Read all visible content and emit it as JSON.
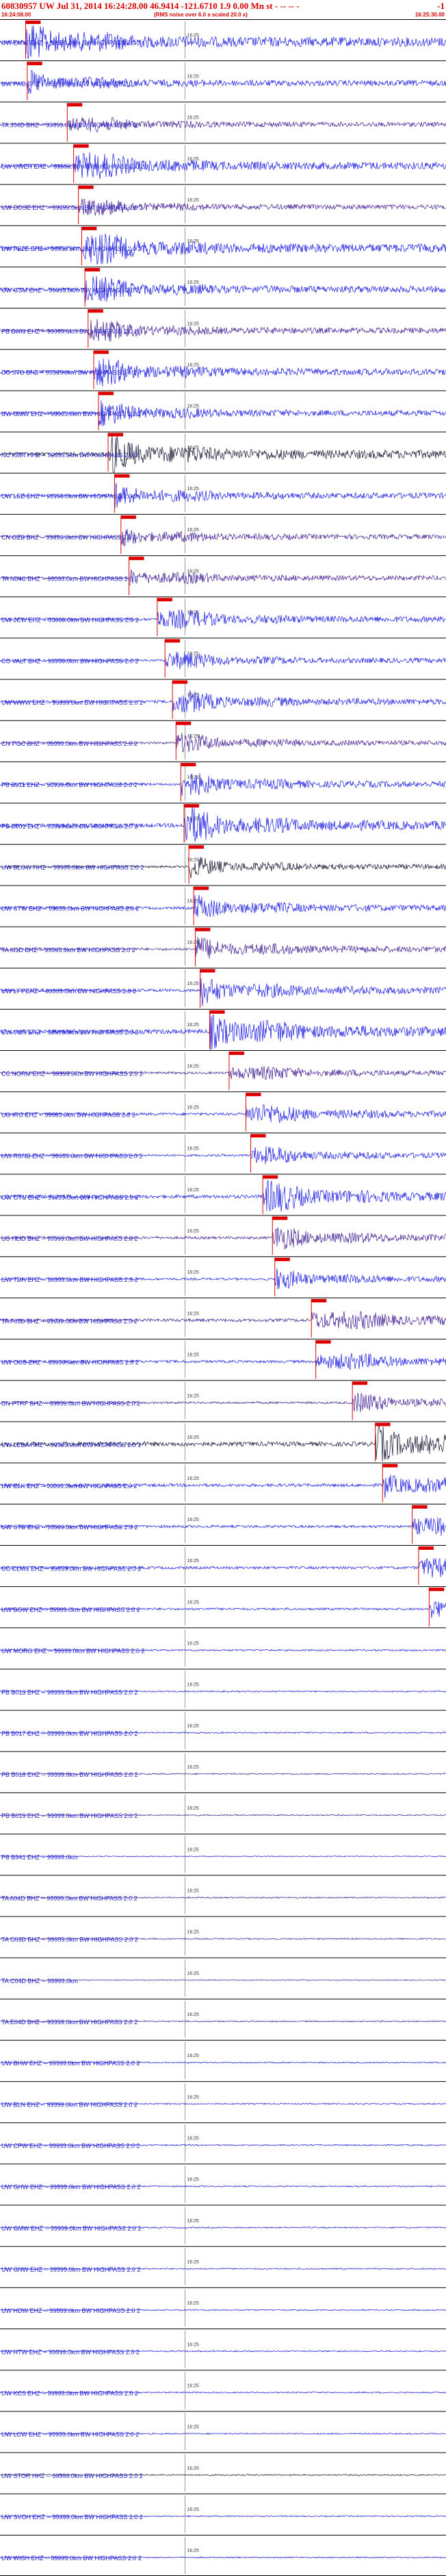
{
  "header": {
    "title": "60830957 UW Jul 31, 2014 16:24:28.00    46.9414 -121.6710  1.9 0.00 Mn st   - -- -- -",
    "right": "-1",
    "start_time": "16:24:08.00",
    "end_time": "16:25:30.00",
    "note": "(RMS noise over 6.0 s scaled 20.0 x)"
  },
  "colors": {
    "trace_blue": "#1515e0",
    "trace_dark": "#101030",
    "trace_purple": "#3a1590",
    "pick": "#dd0000",
    "label": "#1a1acc",
    "tick": "#555555"
  },
  "chart_data": {
    "type": "line",
    "title": "60830957 UW Jul 31, 2014 16:24:28.00  46.9414 -121.6710  1.9 0.00 Mn st",
    "x_range": [
      "16:24:08.00",
      "16:25:30.00"
    ],
    "minute_marker": "16:25",
    "filter": "HIGHPASS  2.0  2",
    "series": [
      {
        "label": "UW EMW EHZ -- 99999.0km BW HIGHPASS  2.0  2",
        "pick": 0.0574,
        "amp": 1.0,
        "color": "blue"
      },
      {
        "label": "UW PAC EHZ -- 99999.0km BW HIGHPASS  2.0  2",
        "pick": 0.061,
        "amp": 0.6,
        "color": "blue"
      },
      {
        "label": "TA J04D BHZ -- 99999.0km BW HIGHPASS  2.0  2",
        "pick": 0.1508,
        "amp": 0.5,
        "color": "purple"
      },
      {
        "label": "UW UWEH EHZ -- 99999.0km BW HIGHPASS  2.0  2",
        "pick": 0.1651,
        "amp": 0.8,
        "color": "blue"
      },
      {
        "label": "UW DOSE EHZ -- 99999.0km BW HIGHPASS  2.0  2",
        "pick": 0.1759,
        "amp": 0.5,
        "color": "purple"
      },
      {
        "label": "UW PE2E EHZ -- 99999.0km BW HIGHPASS  2.0  2",
        "pick": 0.1831,
        "amp": 0.9,
        "color": "blue"
      },
      {
        "label": "UW GSM EHZ -- 99999.0km BW HIGHPASS  2.0  2",
        "pick": 0.1903,
        "amp": 0.7,
        "color": "blue"
      },
      {
        "label": "PB B003 EHZ -- 99999.0km BW HIGHPASS  2.0  2",
        "pick": 0.1975,
        "amp": 0.6,
        "color": "purple"
      },
      {
        "label": "CC STD BHZ -- 99999.0km BW HIGHPASS  2.0  2",
        "pick": 0.2101,
        "amp": 0.7,
        "color": "blue"
      },
      {
        "label": "UW GMW EHZ -- 99999.0km BW HIGHPASS  2.0  2",
        "pick": 0.2209,
        "amp": 0.6,
        "color": "blue"
      },
      {
        "label": "NC KMR HHZ -- 99999.0km BW HIGHPASS  2.0  2",
        "pick": 0.2424,
        "amp": 0.9,
        "color": "dark"
      },
      {
        "label": "UW LEE EHZ -- 99999.0km BW HIGHPASS  2.0  2",
        "pick": 0.2568,
        "amp": 0.6,
        "color": "blue"
      },
      {
        "label": "CN OZB BHZ -- 99999.0km BW HIGHPASS  2.0  2",
        "pick": 0.2712,
        "amp": 0.5,
        "color": "purple"
      },
      {
        "label": "TA N04C BHZ -- 99999.0km BW HIGHPASS  2.0  2",
        "pick": 0.2892,
        "amp": 0.5,
        "color": "purple"
      },
      {
        "label": "UW JCW EHZ -- 99999.0km BW HIGHPASS  2.0  2",
        "pick": 0.3525,
        "amp": 0.6,
        "color": "blue"
      },
      {
        "label": "CC VALT EHZ -- 99999.0km BW HIGHPASS  2.0  2",
        "pick": 0.3698,
        "amp": 0.5,
        "color": "blue"
      },
      {
        "label": "UW WWW EHZ -- 99999.0km BW HIGHPASS  2.0  2",
        "pick": 0.3867,
        "amp": 0.6,
        "color": "blue"
      },
      {
        "label": "CN PGC BHZ -- 99999.0km BW HIGHPASS  2.0  2",
        "pick": 0.3946,
        "amp": 0.5,
        "color": "purple"
      },
      {
        "label": "PB B011 EHZ -- 99999.0km BW HIGHPASS  2.0  2",
        "pick": 0.4054,
        "amp": 0.6,
        "color": "blue"
      },
      {
        "label": "PB B001 EHZ -- 99999.0km BW HIGHPASS  2.0  2",
        "pick": 0.4126,
        "amp": 0.9,
        "color": "blue"
      },
      {
        "label": "UW BLOW HHZ -- 99999.0km BW HIGHPASS  2.0  2",
        "pick": 0.4234,
        "amp": 0.5,
        "color": "dark"
      },
      {
        "label": "UW STW EHZ -- 99999.0km BW HIGHPASS  2.0  2",
        "pick": 0.4342,
        "amp": 0.6,
        "color": "blue"
      },
      {
        "label": "TA I03D BHZ -- 99999.0km BW HIGHPASS  2.0  2",
        "pick": 0.4378,
        "amp": 0.6,
        "color": "purple"
      },
      {
        "label": "UW LTY EHZ -- 99999.0km BW HIGHPASS  2.0  2",
        "pick": 0.4486,
        "amp": 0.7,
        "color": "blue"
      },
      {
        "label": "UW VCR EHZ -- 99999.0km BW HIGHPASS  2.0  2",
        "pick": 0.4702,
        "amp": 1.0,
        "color": "blue"
      },
      {
        "label": "CC NORM EHZ -- 99999.0km BW HIGHPASS  2.0  2",
        "pick": 0.5137,
        "amp": 0.5,
        "color": "purple"
      },
      {
        "label": "UO IRO EHZ -- 99999.0km BW HIGHPASS  2.0  2",
        "pick": 0.5514,
        "amp": 0.6,
        "color": "blue"
      },
      {
        "label": "UW RSNB EHZ -- 99999.0km BW HIGHPASS  2.0  2",
        "pick": 0.5622,
        "amp": 0.5,
        "color": "blue"
      },
      {
        "label": "UW OTU EHZ -- 99999.0km BW HIGHPASS  2.0  2",
        "pick": 0.5892,
        "amp": 0.8,
        "color": "blue"
      },
      {
        "label": "US HLID BHZ -- 99999.0km BW HIGHPASS  2.0  2",
        "pick": 0.6108,
        "amp": 0.6,
        "color": "purple"
      },
      {
        "label": "UW TDH EHZ -- 99999.0km BW HIGHPASS  2.0  2",
        "pick": 0.6162,
        "amp": 0.5,
        "color": "blue"
      },
      {
        "label": "TA F05D BHZ -- 99999.0km BW HIGHPASS  2.0  2",
        "pick": 0.6982,
        "amp": 0.7,
        "color": "purple"
      },
      {
        "label": "UW OCS EHZ -- 99999.0km BW HIGHPASS  2.0  2",
        "pick": 0.7081,
        "amp": 0.6,
        "color": "blue"
      },
      {
        "label": "CN PTRF BHZ -- 99999.0km BW HIGHPASS  2.0  2",
        "pick": 0.7901,
        "amp": 0.5,
        "color": "purple"
      },
      {
        "label": "UW LEBA HHZ -- 99999.0km BW HIGHPASS  2.0  2",
        "pick": 0.8414,
        "amp": 1.0,
        "color": "dark"
      },
      {
        "label": "UW ELK EHZ -- 99999.0km BW HIGHPASS  2.0  2",
        "pick": 0.8577,
        "amp": 0.7,
        "color": "blue"
      },
      {
        "label": "UW STD EHZ -- 99999.0km BW HIGHPASS  2.0  2",
        "pick": 0.9243,
        "amp": 0.6,
        "color": "blue"
      },
      {
        "label": "CC CLMS EHZ -- 99999.0km BW HIGHPASS  2.0  2",
        "pick": 0.9387,
        "amp": 0.6,
        "color": "blue"
      },
      {
        "label": "UW BOW EHZ -- 99999.0km BW HIGHPASS  2.0  2",
        "pick": 0.9622,
        "amp": 0.5,
        "color": "blue"
      },
      {
        "label": "UW MORO EHZ -- 99999.0km BW HIGHPASS  2.0  2",
        "pick": null,
        "amp": 0.4,
        "color": "blue"
      },
      {
        "label": "PB B013 EHZ -- 99999.0km BW HIGHPASS  2.0  2",
        "pick": null,
        "amp": 0.3,
        "color": "blue"
      },
      {
        "label": "PB B017 EHZ -- 99999.0km BW HIGHPASS  2.0  2",
        "pick": null,
        "amp": 0.3,
        "color": "blue"
      },
      {
        "label": "PB B018 EHZ -- 99999.0km BW HIGHPASS  2.0  2",
        "pick": null,
        "amp": 0.3,
        "color": "purple"
      },
      {
        "label": "PB B019 EHZ -- 99999.0km BW HIGHPASS  2.0  2",
        "pick": null,
        "amp": 0.3,
        "color": "purple"
      },
      {
        "label": "PB B941 EHZ -- 99999.0km",
        "pick": null,
        "amp": 0.2,
        "color": "blue"
      },
      {
        "label": "TA A04D BHZ -- 99999.0km BW HIGHPASS  2.0  2",
        "pick": null,
        "amp": 0.3,
        "color": "purple"
      },
      {
        "label": "TA C03D BHZ -- 99999.0km BW HIGHPASS  2.0  2",
        "pick": null,
        "amp": 0.3,
        "color": "purple"
      },
      {
        "label": "TA C04D BHZ -- 99999.0km",
        "pick": null,
        "amp": 0.2,
        "color": "purple"
      },
      {
        "label": "TA E04D BHZ -- 99999.0km BW HIGHPASS  2.0  2",
        "pick": null,
        "amp": 0.3,
        "color": "purple"
      },
      {
        "label": "UW BHW EHZ -- 99999.0km BW HIGHPASS  2.0  2",
        "pick": null,
        "amp": 0.3,
        "color": "blue"
      },
      {
        "label": "UW BLN EHZ -- 99999.0km BW HIGHPASS  2.0  2",
        "pick": null,
        "amp": 0.3,
        "color": "blue"
      },
      {
        "label": "UW CPW EHZ -- 99999.0km BW HIGHPASS  2.0  2",
        "pick": null,
        "amp": 0.3,
        "color": "blue"
      },
      {
        "label": "UW GHW EHZ -- 99999.0km BW HIGHPASS  2.0  2",
        "pick": null,
        "amp": 0.3,
        "color": "blue"
      },
      {
        "label": "UW GMW EHZ -- 99999.0km BW HIGHPASS  2.0  2",
        "pick": null,
        "amp": 0.3,
        "color": "blue"
      },
      {
        "label": "UW GNW EHZ -- 99999.0km BW HIGHPASS  2.0  2",
        "pick": null,
        "amp": 0.3,
        "color": "blue"
      },
      {
        "label": "UW HDW EHZ -- 99999.0km BW HIGHPASS  2.0  2",
        "pick": null,
        "amp": 0.3,
        "color": "blue"
      },
      {
        "label": "UW HTW EHZ -- 99999.0km BW HIGHPASS  2.0  2",
        "pick": null,
        "amp": 0.3,
        "color": "blue"
      },
      {
        "label": "UW KCS EHZ -- 99999.0km BW HIGHPASS  2.0  2",
        "pick": null,
        "amp": 0.3,
        "color": "blue"
      },
      {
        "label": "UW LCW EHZ -- 99999.0km BW HIGHPASS  2.0  2",
        "pick": null,
        "amp": 0.3,
        "color": "blue"
      },
      {
        "label": "UW STOR HHZ -- 99999.0km BW HIGHPASS  2.0  2",
        "pick": null,
        "amp": 0.3,
        "color": "dark"
      },
      {
        "label": "UW SVOH EHZ -- 99999.0km BW HIGHPASS  2.0  2",
        "pick": null,
        "amp": 0.3,
        "color": "blue"
      },
      {
        "label": "UW WISH EHZ -- 99999.0km BW HIGHPASS  2.0  2",
        "pick": null,
        "amp": 0.3,
        "color": "blue"
      }
    ]
  }
}
